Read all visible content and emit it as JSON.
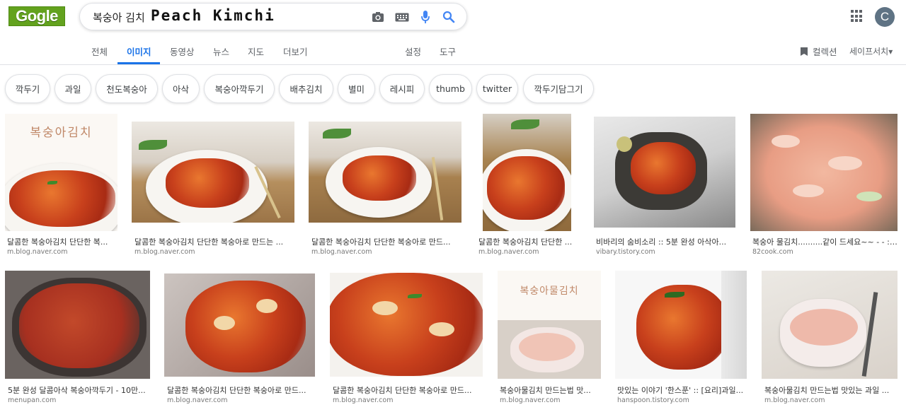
{
  "logo": {
    "text": "Gogle"
  },
  "search": {
    "query_korean": "복숭아 김치",
    "query_english": "Peach Kimchi"
  },
  "tabs": [
    {
      "label": "전체"
    },
    {
      "label": "이미지"
    },
    {
      "label": "동영상"
    },
    {
      "label": "뉴스"
    },
    {
      "label": "지도"
    },
    {
      "label": "더보기"
    },
    {
      "label": "설정"
    },
    {
      "label": "도구"
    }
  ],
  "header_right": {
    "collection_label": "컬렉션",
    "safesearch_label": "세이프서치▾",
    "avatar_letter": "C"
  },
  "chips": [
    "깍두기",
    "과일",
    "천도복숭아",
    "아삭",
    "복숭아깍두기",
    "배추김치",
    "별미",
    "레시피",
    "thumb",
    "twitter",
    "깍두기담그기"
  ],
  "results": [
    {
      "caption": "달콤한 복숭아김치 단단한 복...",
      "source": "m.blog.naver.com",
      "overlay": "복숭아김치"
    },
    {
      "caption": "달콤한 복숭아김치 단단한 복숭아로 만드는 ...",
      "source": "m.blog.naver.com"
    },
    {
      "caption": "달콤한 복숭아김치 단단한 복숭아로 만드...",
      "source": "m.blog.naver.com"
    },
    {
      "caption": "달콤한 복숭아김치 단단한 ...",
      "source": "m.blog.naver.com"
    },
    {
      "caption": "비바리의 숨비소리 :: 5분 완성 아삭아...",
      "source": "vibary.tistory.com"
    },
    {
      "caption": "복숭아 물김치..........같이 드세요~~ - - :::...",
      "source": "82cook.com"
    },
    {
      "caption": "5분 완성 달콤아삭 복숭아깍두기 - 10만...",
      "source": "menupan.com"
    },
    {
      "caption": "달콤한 복숭아김치 단단한 복숭아로 만드...",
      "source": "m.blog.naver.com"
    },
    {
      "caption": "달콤한 복숭아김치 단단한 복숭아로 만드...",
      "source": "m.blog.naver.com"
    },
    {
      "caption": "복숭아물김치 만드는법 맛...",
      "source": "m.blog.naver.com",
      "overlay": "복숭아물김치"
    },
    {
      "caption": "맛있는 이야기 '한스푼' :: [요리]과일...",
      "source": "hanspoon.tistory.com"
    },
    {
      "caption": "복숭아물김치 만드는법 맛있는 과일 ...",
      "source": "m.blog.naver.com"
    }
  ],
  "colors": {
    "accent": "#1a73e8",
    "logo_bg": "#63a21e",
    "text_secondary": "#5f6368"
  },
  "icons": [
    "camera-icon",
    "keyboard-icon",
    "microphone-icon",
    "search-icon",
    "apps-grid-icon",
    "bookmark-icon"
  ]
}
